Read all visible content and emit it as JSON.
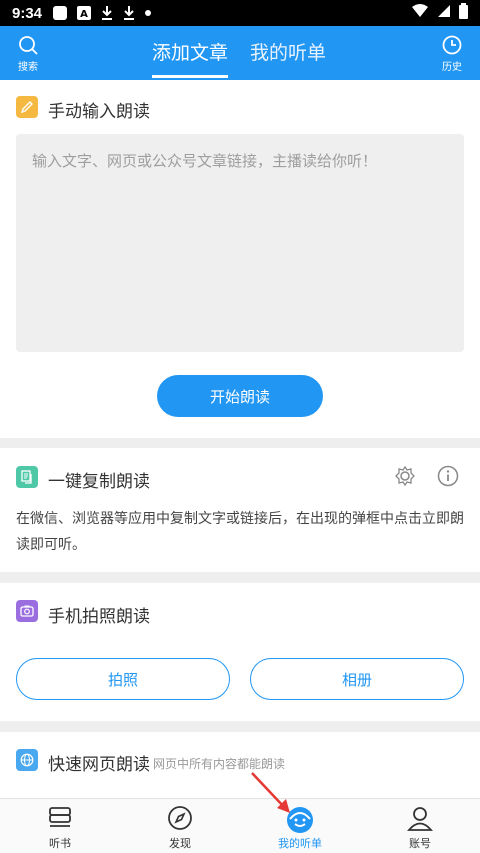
{
  "status_bar": {
    "time": "9:34"
  },
  "header": {
    "search_label": "搜索",
    "history_label": "历史",
    "tabs": [
      {
        "label": "添加文章",
        "active": true
      },
      {
        "label": "我的听单",
        "active": false
      }
    ]
  },
  "manual": {
    "title": "手动输入朗读",
    "placeholder": "输入文字、网页或公众号文章链接，主播读给你听！",
    "start_button": "开始朗读"
  },
  "copy": {
    "title": "一键复制朗读",
    "description": "在微信、浏览器等应用中复制文字或链接后，在出现的弹框中点击立即朗读即可听。"
  },
  "photo": {
    "title": "手机拍照朗读",
    "photo_button": "拍照",
    "album_button": "相册"
  },
  "web": {
    "title": "快速网页朗读",
    "subtitle": "网页中所有内容都能朗读"
  },
  "bottom_nav": [
    {
      "label": "听书",
      "icon": "bookshelf-icon",
      "active": false
    },
    {
      "label": "发现",
      "icon": "compass-icon",
      "active": false
    },
    {
      "label": "我的听单",
      "icon": "smile-headphones-icon",
      "active": true
    },
    {
      "label": "账号",
      "icon": "user-icon",
      "active": false
    }
  ],
  "colors": {
    "accent": "#2196f3",
    "pencil": "#f5b942",
    "copy": "#4fc8a8",
    "camera": "#9b6ee0",
    "globe": "#4aa8f0",
    "annotation_arrow": "#e53935"
  }
}
